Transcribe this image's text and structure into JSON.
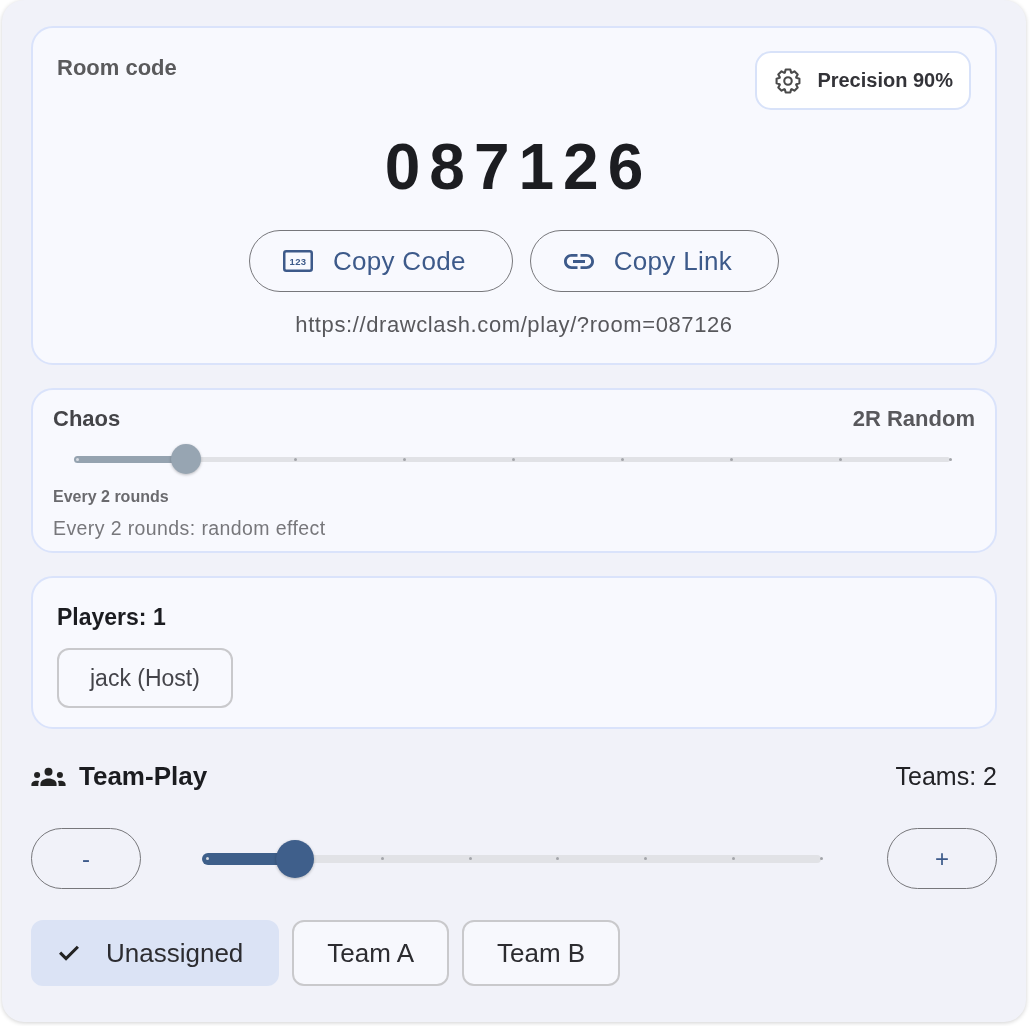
{
  "room": {
    "label": "Room code",
    "precision_button": {
      "label": "Precision 90%"
    },
    "code": "087126",
    "buttons": [
      {
        "kind": "code",
        "label": "Copy Code",
        "icon_label": "123"
      },
      {
        "kind": "link",
        "label": "Copy Link"
      }
    ],
    "url": "https://drawclash.com/play/?room=087126"
  },
  "chaos": {
    "title": "Chaos",
    "value": "2R Random",
    "slider": {
      "level": 0.125
    },
    "caption": "Every 2 rounds",
    "description": "Every 2 rounds: random effect"
  },
  "players": {
    "title": "Players: 1",
    "list": [
      {
        "name": "jack (Host)"
      }
    ]
  },
  "team_play": {
    "title": "Team-Play",
    "count": "Teams: 2",
    "decrement_button": "-",
    "increment_button": "+",
    "slider": {
      "level": 0.1429
    },
    "teams": [
      {
        "label": "Unassigned",
        "selected": true
      },
      {
        "label": "Team A",
        "selected": false
      },
      {
        "label": "Team B",
        "selected": false
      }
    ]
  }
}
